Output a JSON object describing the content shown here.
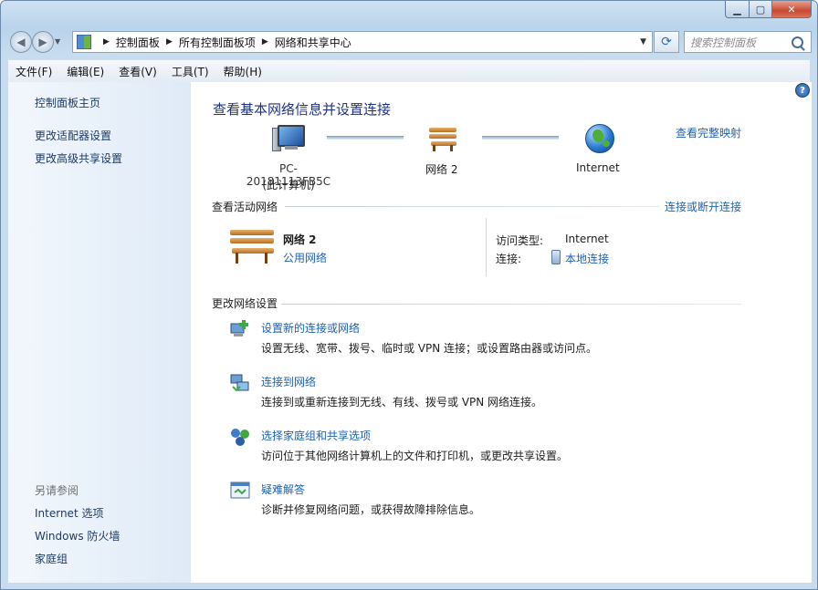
{
  "window": {
    "min_glyph": "▁",
    "max_glyph": "▢",
    "close_glyph": "✕"
  },
  "nav": {
    "back_glyph": "◀",
    "forward_glyph": "▶",
    "breadcrumbs": [
      "控制面板",
      "所有控制面板项",
      "网络和共享中心"
    ],
    "crumb_separator": "▶",
    "search_placeholder": "搜索控制面板",
    "refresh_glyph": "⟳"
  },
  "menu": [
    "文件(F)",
    "编辑(E)",
    "查看(V)",
    "工具(T)",
    "帮助(H)"
  ],
  "sidebar": {
    "items": [
      "控制面板主页",
      "更改适配器设置",
      "更改高级共享设置"
    ],
    "see_also_label": "另请参阅",
    "see_also": [
      "Internet 选项",
      "Windows 防火墙",
      "家庭组"
    ]
  },
  "main": {
    "title": "查看基本网络信息并设置连接",
    "full_map_link": "查看完整映射",
    "map": {
      "computer_name": "PC-20181113FB5C",
      "computer_caption": "(此计算机)",
      "network_name": "网络  2",
      "internet_label": "Internet"
    },
    "active": {
      "header": "查看活动网络",
      "connect_link": "连接或断开连接",
      "network_name": "网络  2",
      "network_type": "公用网络",
      "access_type_label": "访问类型:",
      "access_type_value": "Internet",
      "connections_label": "连接:",
      "connections_value": "本地连接"
    },
    "change": {
      "header": "更改网络设置",
      "tasks": [
        {
          "title": "设置新的连接或网络",
          "desc": "设置无线、宽带、拨号、临时或 VPN 连接；或设置路由器或访问点。"
        },
        {
          "title": "连接到网络",
          "desc": "连接到或重新连接到无线、有线、拨号或 VPN 网络连接。"
        },
        {
          "title": "选择家庭组和共享选项",
          "desc": "访问位于其他网络计算机上的文件和打印机，或更改共享设置。"
        },
        {
          "title": "疑难解答",
          "desc": "诊断并修复网络问题，或获得故障排除信息。"
        }
      ]
    },
    "help_glyph": "?"
  }
}
